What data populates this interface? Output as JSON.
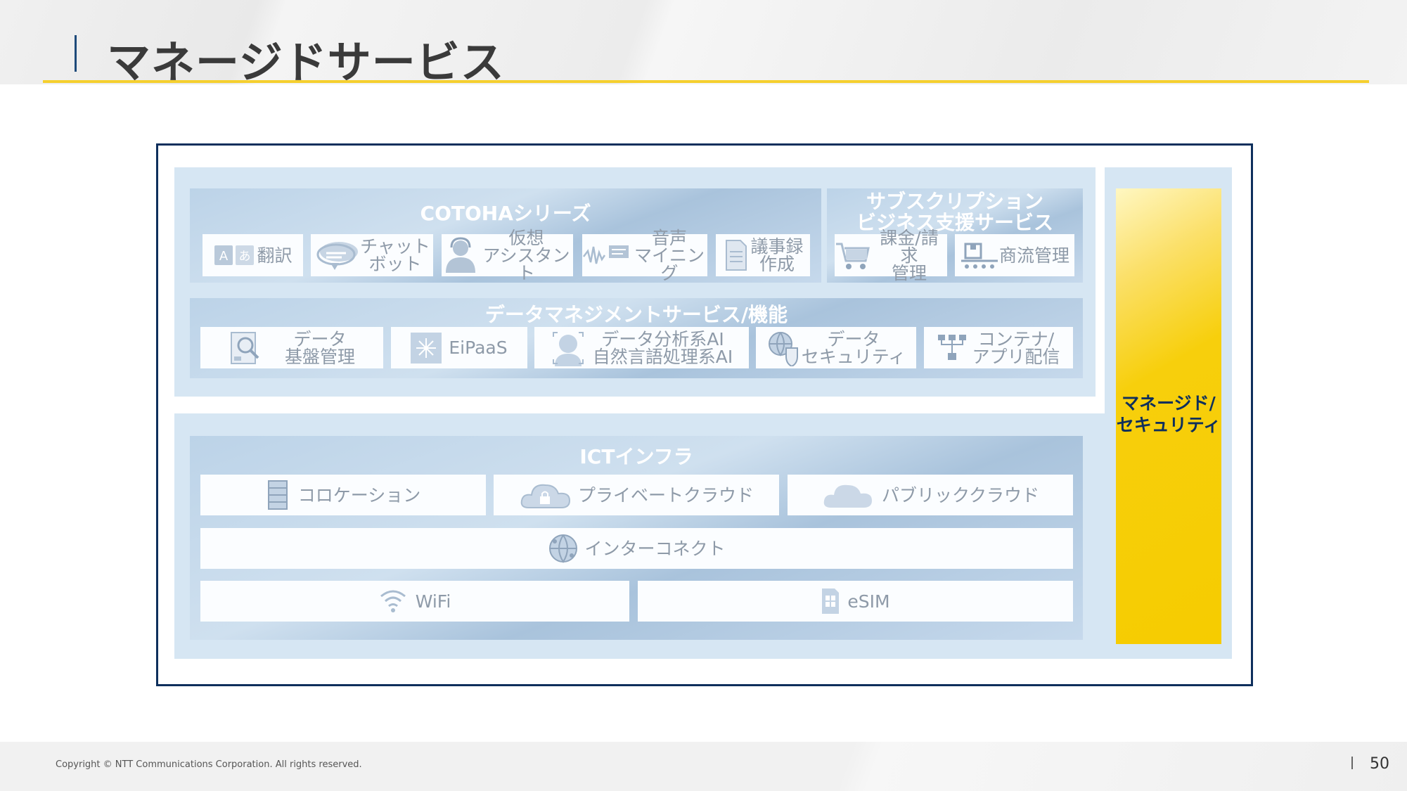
{
  "header": {
    "title": "マネージドサービス"
  },
  "diagram": {
    "cotoha": {
      "title": "COTOHAシリーズ",
      "items": [
        {
          "label": "翻訳",
          "icon": "translate-icon"
        },
        {
          "label": "チャット\nボット",
          "icon": "chat-bubble-icon"
        },
        {
          "label": "仮想\nアシスタント",
          "icon": "headset-person-icon"
        },
        {
          "label": "音声\nマイニング",
          "icon": "sound-wave-icon"
        },
        {
          "label": "議事録\n作成",
          "icon": "document-icon"
        }
      ]
    },
    "subscription": {
      "title": "サブスクリプション\nビジネス支援サービス",
      "items": [
        {
          "label": "課金/請求\n管理",
          "icon": "cart-icon"
        },
        {
          "label": "商流管理",
          "icon": "conveyor-box-icon"
        }
      ]
    },
    "data_mgmt": {
      "title": "データマネジメントサービス/機能",
      "items": [
        {
          "label": "データ\n基盤管理",
          "icon": "data-search-icon"
        },
        {
          "label": "EiPaaS",
          "icon": "eipaas-icon"
        },
        {
          "label": "データ分析系AI\n自然言語処理系AI",
          "icon": "ai-head-icon"
        },
        {
          "label": "データ\nセキュリティ",
          "icon": "globe-shield-icon"
        },
        {
          "label": "コンテナ/\nアプリ配信",
          "icon": "network-tree-icon"
        }
      ]
    },
    "ict": {
      "title": "ICTインフラ",
      "row1": [
        {
          "label": "コロケーション",
          "icon": "server-rack-icon"
        },
        {
          "label": "プライベートクラウド",
          "icon": "cloud-lock-icon"
        },
        {
          "label": "パブリッククラウド",
          "icon": "cloud-icon"
        }
      ],
      "row2": {
        "label": "インターコネクト",
        "icon": "globe-network-icon"
      },
      "row3": [
        {
          "label": "WiFi",
          "icon": "wifi-icon"
        },
        {
          "label": "eSIM",
          "icon": "sim-card-icon"
        }
      ]
    },
    "side": {
      "label": "マネージド/\nセキュリティ"
    }
  },
  "footer": {
    "copyright": "Copyright © NTT Communications Corporation. All rights reserved.",
    "page": "50"
  }
}
